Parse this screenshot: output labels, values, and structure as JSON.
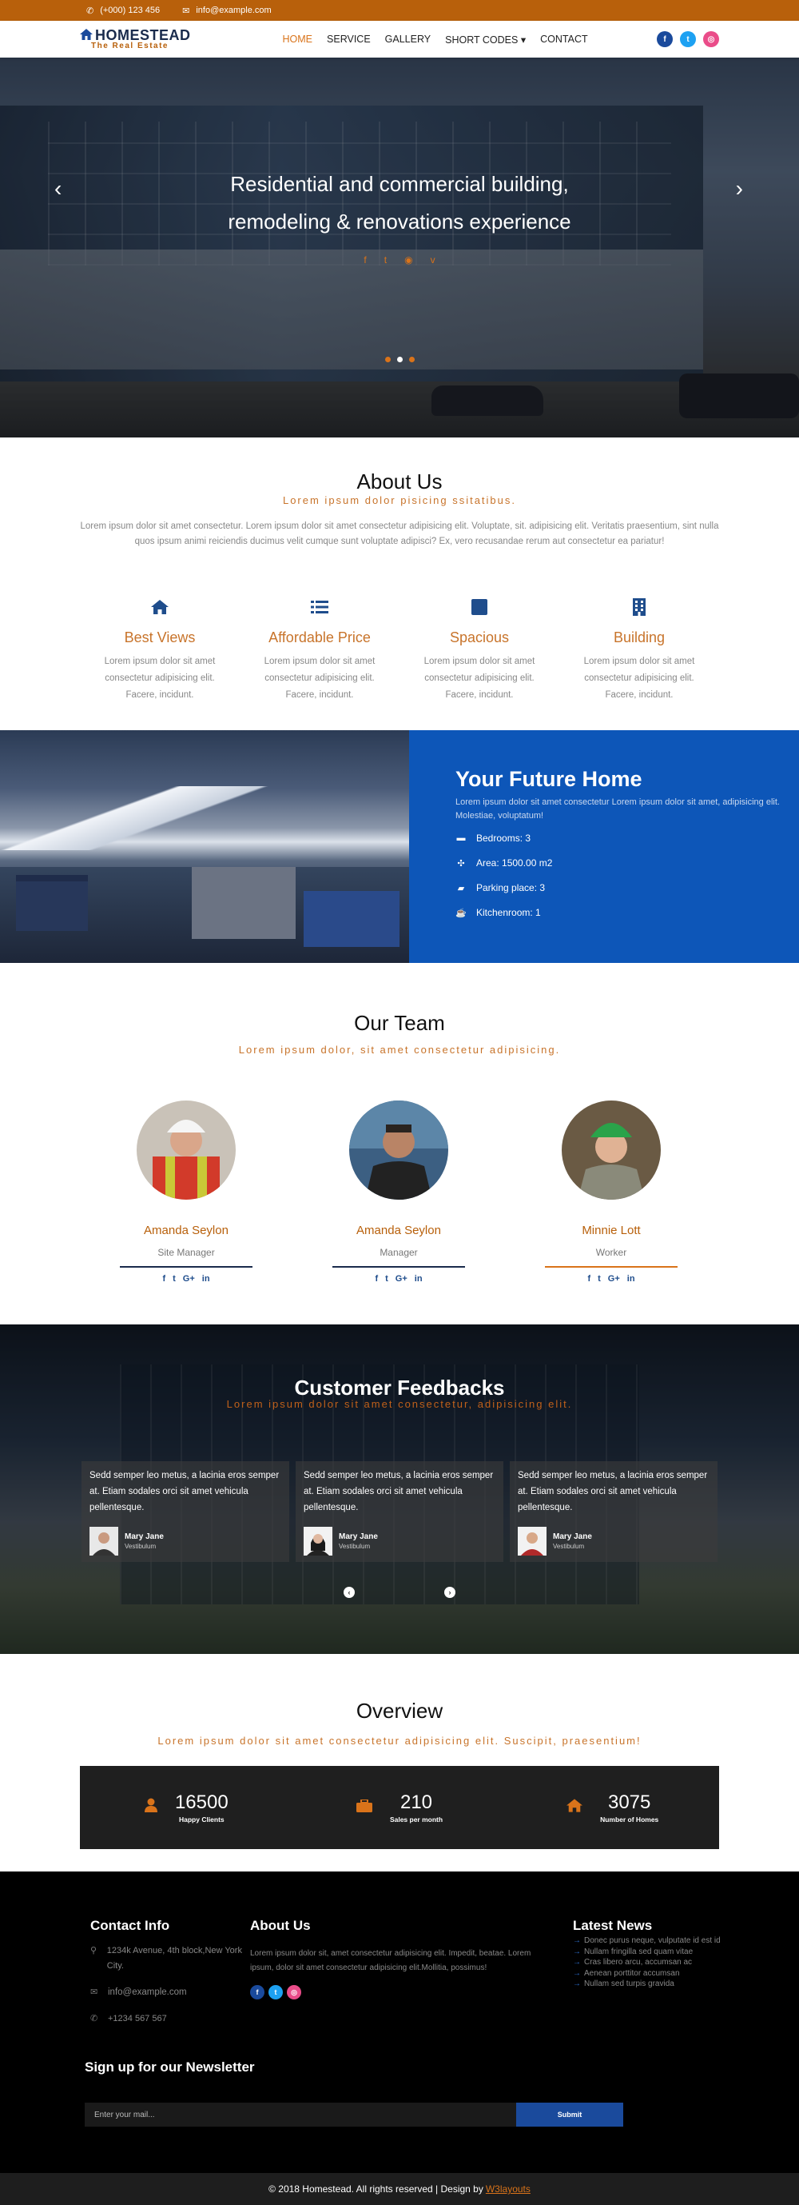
{
  "topbar": {
    "phone": "(+000) 123 456",
    "email": "info@example.com"
  },
  "nav": {
    "logo": "HOMESTEAD",
    "tagline": "The Real Estate",
    "menu": [
      "HOME",
      "SERVICE",
      "GALLERY",
      "SHORT CODES",
      "CONTACT"
    ],
    "active": "HOME"
  },
  "hero": {
    "line1": "Residential and commercial building,",
    "line2": "remodeling & renovations experience",
    "prev": "‹",
    "next": "›"
  },
  "about": {
    "title": "About Us",
    "subtitle": "Lorem ipsum dolor pisicing ssitatibus.",
    "intro": "Lorem ipsum dolor sit amet consectetur. Lorem ipsum dolor sit amet consectetur adipisicing elit. Voluptate, sit. adipisicing elit. Veritatis praesentium, sint nulla quos ipsum animi reiciendis ducimus velit cumque sunt voluptate adipisci? Ex, vero recusandae rerum aut consectetur ea pariatur!",
    "features": [
      {
        "icon": "home-icon",
        "title": "Best Views",
        "text": "Lorem ipsum dolor sit amet consectetur adipisicing elit. Facere, incidunt."
      },
      {
        "icon": "list-icon",
        "title": "Affordable Price",
        "text": "Lorem ipsum dolor sit amet consectetur adipisicing elit. Facere, incidunt."
      },
      {
        "icon": "square-icon",
        "title": "Spacious",
        "text": "Lorem ipsum dolor sit amet consectetur adipisicing elit. Facere, incidunt."
      },
      {
        "icon": "building-icon",
        "title": "Building",
        "text": "Lorem ipsum dolor sit amet consectetur adipisicing elit. Facere, incidunt."
      }
    ]
  },
  "future": {
    "title": "Your Future Home",
    "desc": "Lorem ipsum dolor sit amet consectetur Lorem ipsum dolor sit amet, adipisicing elit. Molestiae, voluptatum!",
    "items": [
      {
        "icon": "bed-icon",
        "text": "Bedrooms: 3"
      },
      {
        "icon": "area-icon",
        "text": "Area: 1500.00 m2"
      },
      {
        "icon": "car-icon",
        "text": "Parking place: 3"
      },
      {
        "icon": "cup-icon",
        "text": "Kitchenroom: 1"
      }
    ]
  },
  "team": {
    "title": "Our Team",
    "subtitle": "Lorem ipsum dolor, sit amet consectetur adipisicing.",
    "members": [
      {
        "name": "Amanda Seylon",
        "role": "Site Manager"
      },
      {
        "name": "Amanda Seylon",
        "role": "Manager"
      },
      {
        "name": "Minnie Lott",
        "role": "Worker"
      }
    ]
  },
  "feedback": {
    "title": "Customer Feedbacks",
    "subtitle": "Lorem ipsum dolor sit amet consectetur, adipisicing elit.",
    "cards": [
      {
        "text": "Sedd semper leo metus, a lacinia eros semper at. Etiam sodales orci sit amet vehicula pellentesque.",
        "name": "Mary Jane",
        "title": "Vestibulum"
      },
      {
        "text": "Sedd semper leo metus, a lacinia eros semper at. Etiam sodales orci sit amet vehicula pellentesque.",
        "name": "Mary Jane",
        "title": "Vestibulum"
      },
      {
        "text": "Sedd semper leo metus, a lacinia eros semper at. Etiam sodales orci sit amet vehicula pellentesque.",
        "name": "Mary Jane",
        "title": "Vestibulum"
      }
    ]
  },
  "overview": {
    "title": "Overview",
    "subtitle": "Lorem ipsum dolor sit amet consectetur adipisicing elit. Suscipit, praesentium!",
    "stats": [
      {
        "icon": "user-icon",
        "value": "16500",
        "label": "Happy Clients"
      },
      {
        "icon": "briefcase-icon",
        "value": "210",
        "label": "Sales per month"
      },
      {
        "icon": "home-icon",
        "value": "3075",
        "label": "Number of Homes"
      }
    ]
  },
  "footer": {
    "contact_title": "Contact Info",
    "address": "1234k Avenue, 4th block,New York City.",
    "email": "info@example.com",
    "phone": "+1234 567 567",
    "about_title": "About Us",
    "about_text": "Lorem ipsum dolor sit, amet consectetur adipisicing elit. Impedit, beatae. Lorem ipsum, dolor sit amet consectetur adipisicing elit.Mollitia, possimus!",
    "news_title": "Latest News",
    "news": [
      "Donec purus neque, vulputate id est id",
      "Nullam fringilla sed quam vitae",
      "Cras libero arcu, accumsan ac",
      "Aenean porttitor accumsan",
      "Nullam sed turpis gravida"
    ],
    "newsletter_title": "Sign up for our Newsletter",
    "newsletter_placeholder": "Enter your mail...",
    "submit": "Submit",
    "copyright": "© 2018 Homestead. All rights reserved | Design by",
    "designer": "W3layouts"
  },
  "colors": {
    "accent": "#b8600b",
    "blue": "#0d56b8",
    "navy": "#1a2b4c"
  }
}
